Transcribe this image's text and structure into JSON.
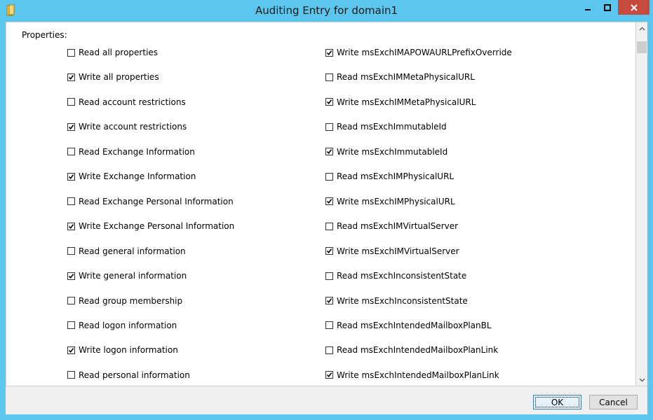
{
  "window": {
    "title": "Auditing Entry for domain1",
    "accent": "#5cc7ee",
    "close_color": "#c74a3e"
  },
  "content": {
    "properties_label": "Properties:"
  },
  "left_column": [
    {
      "label": "Read all properties",
      "checked": false
    },
    {
      "label": "Write all properties",
      "checked": true
    },
    {
      "label": "Read account restrictions",
      "checked": false
    },
    {
      "label": "Write account restrictions",
      "checked": true
    },
    {
      "label": "Read Exchange Information",
      "checked": false
    },
    {
      "label": "Write Exchange Information",
      "checked": true
    },
    {
      "label": "Read Exchange Personal Information",
      "checked": false
    },
    {
      "label": "Write Exchange Personal Information",
      "checked": true
    },
    {
      "label": "Read general information",
      "checked": false
    },
    {
      "label": "Write general information",
      "checked": true
    },
    {
      "label": "Read group membership",
      "checked": false
    },
    {
      "label": "Read logon information",
      "checked": false
    },
    {
      "label": "Write logon information",
      "checked": true
    },
    {
      "label": "Read personal information",
      "checked": false
    }
  ],
  "right_column": [
    {
      "label": "Write msExchIMAPOWAURLPrefixOverride",
      "checked": true
    },
    {
      "label": "Read msExchIMMetaPhysicalURL",
      "checked": false
    },
    {
      "label": "Write msExchIMMetaPhysicalURL",
      "checked": true
    },
    {
      "label": "Read msExchImmutableId",
      "checked": false
    },
    {
      "label": "Write msExchImmutableId",
      "checked": true
    },
    {
      "label": "Read msExchIMPhysicalURL",
      "checked": false
    },
    {
      "label": "Write msExchIMPhysicalURL",
      "checked": true
    },
    {
      "label": "Read msExchIMVirtualServer",
      "checked": false
    },
    {
      "label": "Write msExchIMVirtualServer",
      "checked": true
    },
    {
      "label": "Read msExchInconsistentState",
      "checked": false
    },
    {
      "label": "Write msExchInconsistentState",
      "checked": true
    },
    {
      "label": "Read msExchIntendedMailboxPlanBL",
      "checked": false
    },
    {
      "label": "Read msExchIntendedMailboxPlanLink",
      "checked": false
    },
    {
      "label": "Write msExchIntendedMailboxPlanLink",
      "checked": true
    }
  ],
  "buttons": {
    "ok": "OK",
    "cancel": "Cancel"
  },
  "icons": {
    "app": "folder-icon",
    "minimize": "minimize-icon",
    "maximize": "maximize-icon",
    "close": "close-icon",
    "scroll_up": "chevron-up-icon",
    "scroll_down": "chevron-down-icon",
    "check": "checkmark-icon"
  }
}
